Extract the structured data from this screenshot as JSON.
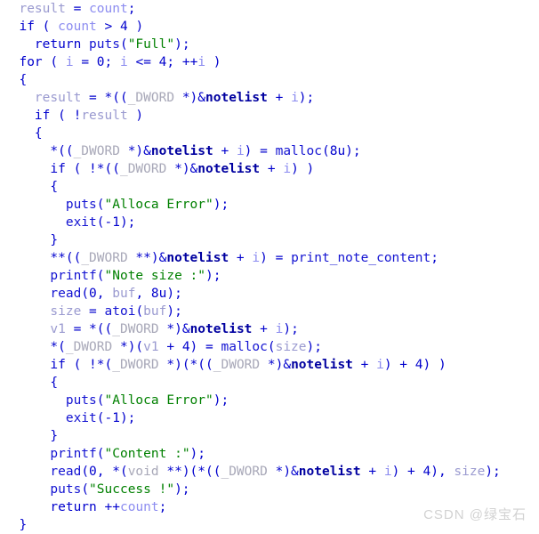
{
  "editor": {
    "name": "pseudocode-view",
    "background": "#ffffff",
    "font_size_px": 14.5,
    "line_height_px": 20
  },
  "colors": {
    "default": "#0000cd",
    "keyword": "#0000cd",
    "function": "#1414d2",
    "string": "#008000",
    "type": "#a8a8b8",
    "variable": "#9a9ad0",
    "global": "#0000a0",
    "loop_variable": "#8c8cf0",
    "watermark": "#d2d2d2"
  },
  "watermark": {
    "text": "CSDN @绿宝石"
  },
  "lines": [
    [
      {
        "t": "  ",
        "c": "plain"
      },
      {
        "t": "result",
        "c": "var"
      },
      {
        "t": " = ",
        "c": "plain"
      },
      {
        "t": "count",
        "c": "loopvar"
      },
      {
        "t": ";",
        "c": "plain"
      }
    ],
    [
      {
        "t": "  ",
        "c": "plain"
      },
      {
        "t": "if",
        "c": "keyword"
      },
      {
        "t": " ( ",
        "c": "plain"
      },
      {
        "t": "count",
        "c": "loopvar"
      },
      {
        "t": " > 4 )",
        "c": "plain"
      }
    ],
    [
      {
        "t": "    ",
        "c": "plain"
      },
      {
        "t": "return",
        "c": "keyword"
      },
      {
        "t": " ",
        "c": "plain"
      },
      {
        "t": "puts",
        "c": "func"
      },
      {
        "t": "(",
        "c": "plain"
      },
      {
        "t": "\"Full\"",
        "c": "string"
      },
      {
        "t": ");",
        "c": "plain"
      }
    ],
    [
      {
        "t": "  ",
        "c": "plain"
      },
      {
        "t": "for",
        "c": "keyword"
      },
      {
        "t": " ( ",
        "c": "plain"
      },
      {
        "t": "i",
        "c": "loopvar"
      },
      {
        "t": " = 0; ",
        "c": "plain"
      },
      {
        "t": "i",
        "c": "loopvar"
      },
      {
        "t": " <= 4; ++",
        "c": "plain"
      },
      {
        "t": "i",
        "c": "loopvar"
      },
      {
        "t": " )",
        "c": "plain"
      }
    ],
    [
      {
        "t": "  {",
        "c": "plain"
      }
    ],
    [
      {
        "t": "    ",
        "c": "plain"
      },
      {
        "t": "result",
        "c": "var"
      },
      {
        "t": " = *((",
        "c": "plain"
      },
      {
        "t": "_DWORD",
        "c": "type"
      },
      {
        "t": " *)&",
        "c": "plain"
      },
      {
        "t": "notelist",
        "c": "global"
      },
      {
        "t": " + ",
        "c": "plain"
      },
      {
        "t": "i",
        "c": "loopvar"
      },
      {
        "t": ");",
        "c": "plain"
      }
    ],
    [
      {
        "t": "    ",
        "c": "plain"
      },
      {
        "t": "if",
        "c": "keyword"
      },
      {
        "t": " ( !",
        "c": "plain"
      },
      {
        "t": "result",
        "c": "var"
      },
      {
        "t": " )",
        "c": "plain"
      }
    ],
    [
      {
        "t": "    {",
        "c": "plain"
      }
    ],
    [
      {
        "t": "      *((",
        "c": "plain"
      },
      {
        "t": "_DWORD",
        "c": "type"
      },
      {
        "t": " *)&",
        "c": "plain"
      },
      {
        "t": "notelist",
        "c": "global"
      },
      {
        "t": " + ",
        "c": "plain"
      },
      {
        "t": "i",
        "c": "loopvar"
      },
      {
        "t": ") = ",
        "c": "plain"
      },
      {
        "t": "malloc",
        "c": "func"
      },
      {
        "t": "(8u);",
        "c": "plain"
      }
    ],
    [
      {
        "t": "      ",
        "c": "plain"
      },
      {
        "t": "if",
        "c": "keyword"
      },
      {
        "t": " ( !*((",
        "c": "plain"
      },
      {
        "t": "_DWORD",
        "c": "type"
      },
      {
        "t": " *)&",
        "c": "plain"
      },
      {
        "t": "notelist",
        "c": "global"
      },
      {
        "t": " + ",
        "c": "plain"
      },
      {
        "t": "i",
        "c": "loopvar"
      },
      {
        "t": ") )",
        "c": "plain"
      }
    ],
    [
      {
        "t": "      {",
        "c": "plain"
      }
    ],
    [
      {
        "t": "        ",
        "c": "plain"
      },
      {
        "t": "puts",
        "c": "func"
      },
      {
        "t": "(",
        "c": "plain"
      },
      {
        "t": "\"Alloca Error\"",
        "c": "string"
      },
      {
        "t": ");",
        "c": "plain"
      }
    ],
    [
      {
        "t": "        ",
        "c": "plain"
      },
      {
        "t": "exit",
        "c": "func"
      },
      {
        "t": "(-1);",
        "c": "plain"
      }
    ],
    [
      {
        "t": "      }",
        "c": "plain"
      }
    ],
    [
      {
        "t": "      **((",
        "c": "plain"
      },
      {
        "t": "_DWORD",
        "c": "type"
      },
      {
        "t": " **)&",
        "c": "plain"
      },
      {
        "t": "notelist",
        "c": "global"
      },
      {
        "t": " + ",
        "c": "plain"
      },
      {
        "t": "i",
        "c": "loopvar"
      },
      {
        "t": ") = ",
        "c": "plain"
      },
      {
        "t": "print_note_content",
        "c": "func"
      },
      {
        "t": ";",
        "c": "plain"
      }
    ],
    [
      {
        "t": "      ",
        "c": "plain"
      },
      {
        "t": "printf",
        "c": "func"
      },
      {
        "t": "(",
        "c": "plain"
      },
      {
        "t": "\"Note size :\"",
        "c": "string"
      },
      {
        "t": ");",
        "c": "plain"
      }
    ],
    [
      {
        "t": "      ",
        "c": "plain"
      },
      {
        "t": "read",
        "c": "func"
      },
      {
        "t": "(0, ",
        "c": "plain"
      },
      {
        "t": "buf",
        "c": "var"
      },
      {
        "t": ", 8u);",
        "c": "plain"
      }
    ],
    [
      {
        "t": "      ",
        "c": "plain"
      },
      {
        "t": "size",
        "c": "var"
      },
      {
        "t": " = ",
        "c": "plain"
      },
      {
        "t": "atoi",
        "c": "func"
      },
      {
        "t": "(",
        "c": "plain"
      },
      {
        "t": "buf",
        "c": "var"
      },
      {
        "t": ");",
        "c": "plain"
      }
    ],
    [
      {
        "t": "      ",
        "c": "plain"
      },
      {
        "t": "v1",
        "c": "var"
      },
      {
        "t": " = *((",
        "c": "plain"
      },
      {
        "t": "_DWORD",
        "c": "type"
      },
      {
        "t": " *)&",
        "c": "plain"
      },
      {
        "t": "notelist",
        "c": "global"
      },
      {
        "t": " + ",
        "c": "plain"
      },
      {
        "t": "i",
        "c": "loopvar"
      },
      {
        "t": ");",
        "c": "plain"
      }
    ],
    [
      {
        "t": "      *(",
        "c": "plain"
      },
      {
        "t": "_DWORD",
        "c": "type"
      },
      {
        "t": " *)(",
        "c": "plain"
      },
      {
        "t": "v1",
        "c": "var"
      },
      {
        "t": " + 4) = ",
        "c": "plain"
      },
      {
        "t": "malloc",
        "c": "func"
      },
      {
        "t": "(",
        "c": "plain"
      },
      {
        "t": "size",
        "c": "var"
      },
      {
        "t": ");",
        "c": "plain"
      }
    ],
    [
      {
        "t": "      ",
        "c": "plain"
      },
      {
        "t": "if",
        "c": "keyword"
      },
      {
        "t": " ( !*(",
        "c": "plain"
      },
      {
        "t": "_DWORD",
        "c": "type"
      },
      {
        "t": " *)(*((",
        "c": "plain"
      },
      {
        "t": "_DWORD",
        "c": "type"
      },
      {
        "t": " *)&",
        "c": "plain"
      },
      {
        "t": "notelist",
        "c": "global"
      },
      {
        "t": " + ",
        "c": "plain"
      },
      {
        "t": "i",
        "c": "loopvar"
      },
      {
        "t": ") + 4) )",
        "c": "plain"
      }
    ],
    [
      {
        "t": "      {",
        "c": "plain"
      }
    ],
    [
      {
        "t": "        ",
        "c": "plain"
      },
      {
        "t": "puts",
        "c": "func"
      },
      {
        "t": "(",
        "c": "plain"
      },
      {
        "t": "\"Alloca Error\"",
        "c": "string"
      },
      {
        "t": ");",
        "c": "plain"
      }
    ],
    [
      {
        "t": "        ",
        "c": "plain"
      },
      {
        "t": "exit",
        "c": "func"
      },
      {
        "t": "(-1);",
        "c": "plain"
      }
    ],
    [
      {
        "t": "      }",
        "c": "plain"
      }
    ],
    [
      {
        "t": "      ",
        "c": "plain"
      },
      {
        "t": "printf",
        "c": "func"
      },
      {
        "t": "(",
        "c": "plain"
      },
      {
        "t": "\"Content :\"",
        "c": "string"
      },
      {
        "t": ");",
        "c": "plain"
      }
    ],
    [
      {
        "t": "      ",
        "c": "plain"
      },
      {
        "t": "read",
        "c": "func"
      },
      {
        "t": "(0, *(",
        "c": "plain"
      },
      {
        "t": "void",
        "c": "type"
      },
      {
        "t": " **)(*((",
        "c": "plain"
      },
      {
        "t": "_DWORD",
        "c": "type"
      },
      {
        "t": " *)&",
        "c": "plain"
      },
      {
        "t": "notelist",
        "c": "global"
      },
      {
        "t": " + ",
        "c": "plain"
      },
      {
        "t": "i",
        "c": "loopvar"
      },
      {
        "t": ") + 4), ",
        "c": "plain"
      },
      {
        "t": "size",
        "c": "var"
      },
      {
        "t": ");",
        "c": "plain"
      }
    ],
    [
      {
        "t": "      ",
        "c": "plain"
      },
      {
        "t": "puts",
        "c": "func"
      },
      {
        "t": "(",
        "c": "plain"
      },
      {
        "t": "\"Success !\"",
        "c": "string"
      },
      {
        "t": ");",
        "c": "plain"
      }
    ],
    [
      {
        "t": "      ",
        "c": "plain"
      },
      {
        "t": "return",
        "c": "keyword"
      },
      {
        "t": " ++",
        "c": "plain"
      },
      {
        "t": "count",
        "c": "loopvar"
      },
      {
        "t": ";",
        "c": "plain"
      }
    ],
    [
      {
        "t": "  }",
        "c": "plain"
      }
    ]
  ]
}
